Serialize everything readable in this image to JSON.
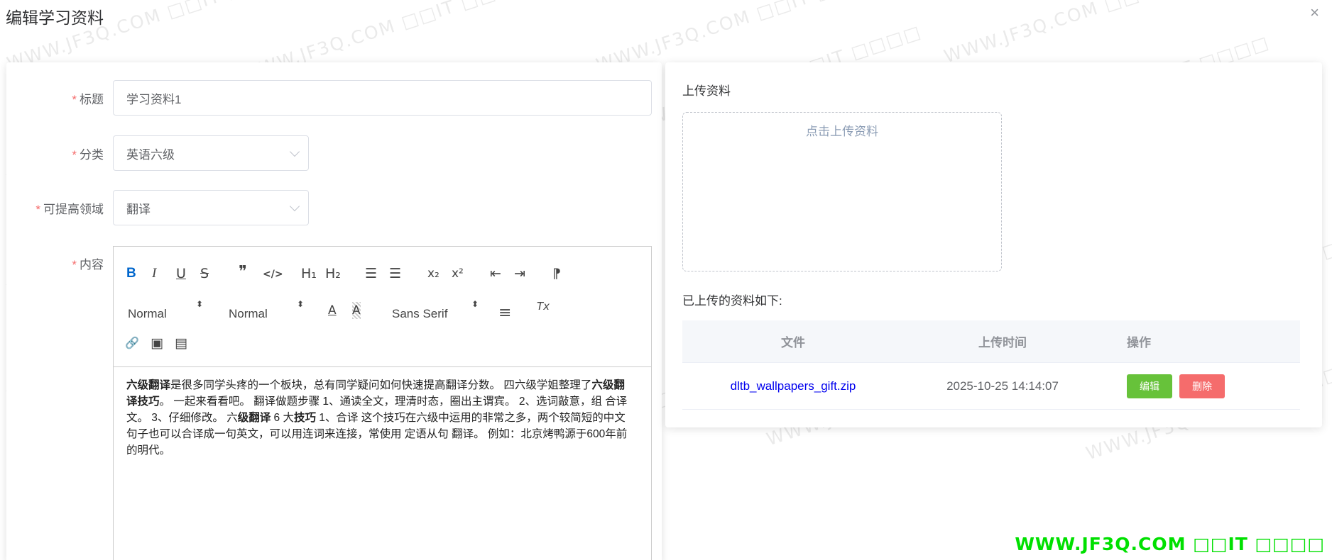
{
  "dialog": {
    "title": "编辑学习资料",
    "close_glyph": "×"
  },
  "form": {
    "title": {
      "label": "标题",
      "value": "学习资料1"
    },
    "category": {
      "label": "分类",
      "value": "英语六级"
    },
    "area": {
      "label": "可提高领域",
      "value": "翻译"
    },
    "content": {
      "label": "内容"
    },
    "required_mark": "*"
  },
  "editor": {
    "toolbar": {
      "bold": "B",
      "italic": "I",
      "underline": "U",
      "strike": "S",
      "quote": "❞",
      "code": "</>",
      "h1": "H₁",
      "h2": "H₂",
      "ordered_list": "☰",
      "bullet_list": "☰",
      "subscript": "x₂",
      "superscript": "x²",
      "outdent": "⇤",
      "indent": "⇥",
      "rtl": "⁋",
      "size_picker": "Normal",
      "header_picker": "Normal",
      "font_picker": "Sans Serif",
      "color": "A",
      "background": "A",
      "align": "≡",
      "clean": "Tx",
      "link": "🔗",
      "image": "▣",
      "video": "▤"
    },
    "content": {
      "s1": "六级翻译",
      "t1": "是很多同学头疼的一个板块，总有同学疑问如何快速提高翻译分数。 四六级学姐整理了",
      "s2": "六级翻译技巧",
      "t2": "。 一起来看看吧。 翻译做题步骤 1、通读全文，理清时态，圈出主谓宾。 2、选词敲意，组 合译 文。 3、仔细修改。 六",
      "s3": "级翻译",
      "t3": " 6 大",
      "s4": "技巧",
      "t4": " 1、合译 这个技巧在六级中运用的非常之多，两个较简短的中文句子也可以合译成一句英文，可以用连词来连接，常使用 定语从句 翻译。 例如：北京烤鸭源于600年前的明代。"
    }
  },
  "upload": {
    "section_title": "上传资料",
    "upload_hint": "点击上传资料",
    "list_title": "已上传的资料如下:",
    "table": {
      "headers": {
        "file": "文件",
        "time": "上传时间",
        "ops": "操作"
      },
      "rows": [
        {
          "file": "dltb_wallpapers_gift.zip",
          "time": "2025-10-25 14:14:07",
          "edit": "编辑",
          "delete": "删除"
        }
      ]
    }
  },
  "watermark": {
    "text": "WWW.JF3Q.COM □□IT □□□□",
    "green_text": "WWW.JF3Q.COM □□IT □□□□"
  }
}
